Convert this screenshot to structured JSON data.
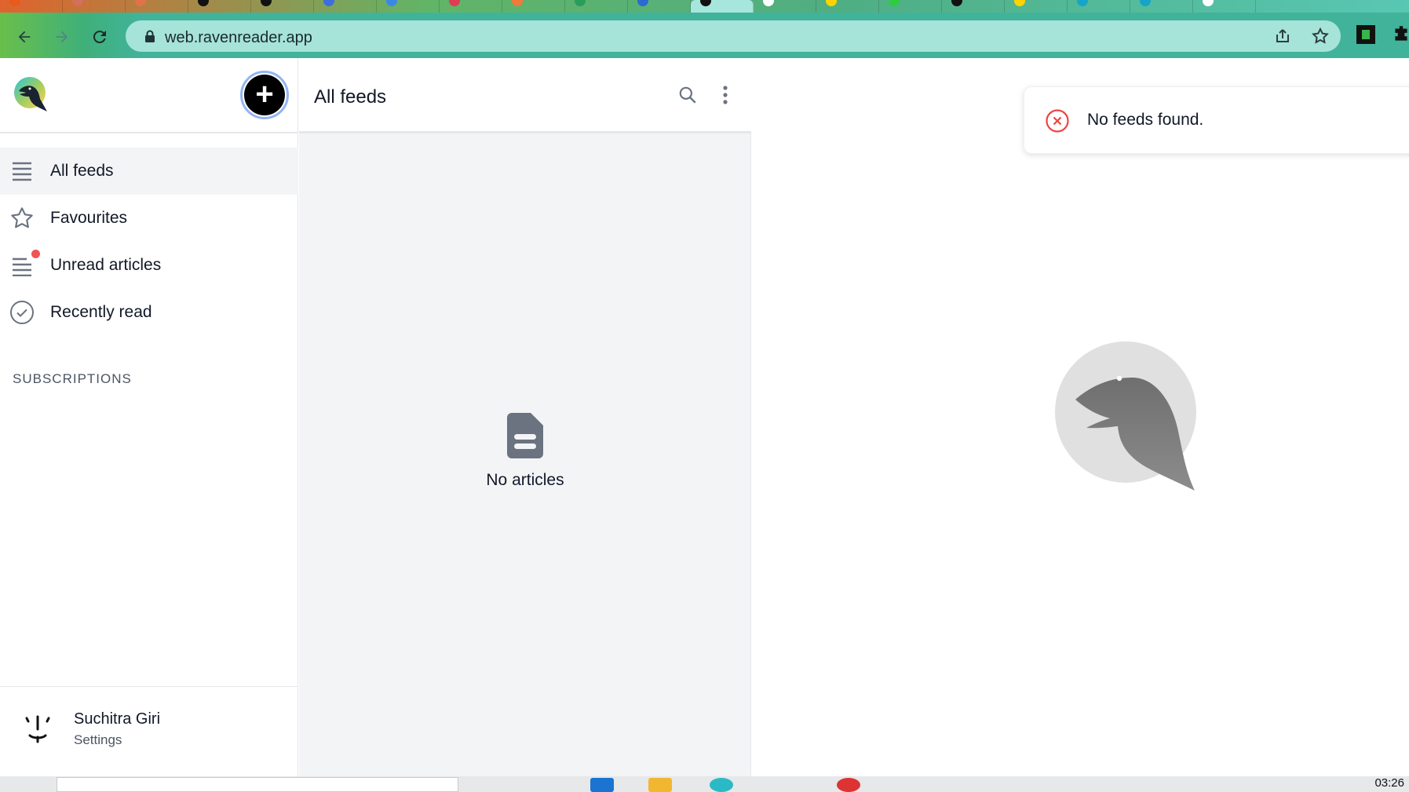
{
  "browser": {
    "url": "web.ravenreader.app",
    "tab_favicons": [
      "#e85a1e",
      "#d36f5a",
      "#e0724a",
      "#111111",
      "#111111",
      "#3b6fdd",
      "#3a88e6",
      "#e23b55",
      "#f07a3a",
      "#2a9d5b",
      "#2b6ad1",
      "#111111",
      "#ffffff",
      "#ffd400",
      "#2ecc40",
      "#111111",
      "#ffd400",
      "#16a5c7",
      "#16a5c7",
      "#ffffff"
    ]
  },
  "sidebar": {
    "logo": "raven-logo",
    "add_button_label": "+",
    "nav": [
      {
        "label": "All feeds",
        "icon": "list-icon",
        "active": true
      },
      {
        "label": "Favourites",
        "icon": "star-icon",
        "active": false
      },
      {
        "label": "Unread articles",
        "icon": "unread-list-icon",
        "active": false
      },
      {
        "label": "Recently read",
        "icon": "check-circle-icon",
        "active": false
      }
    ],
    "subscriptions_title": "SUBSCRIPTIONS",
    "user": {
      "name": "Suchitra Giri",
      "settings_label": "Settings"
    }
  },
  "list": {
    "title": "All feeds",
    "empty_text": "No articles"
  },
  "toast": {
    "message": "No feeds found.",
    "icon": "error-circle-icon"
  },
  "taskbar": {
    "clock": "03:26"
  },
  "colors": {
    "accent_dot": "#f05454",
    "omnibox": "#a6e3d9",
    "toolbar": "#41b39a",
    "list_bg": "#f3f4f6"
  }
}
